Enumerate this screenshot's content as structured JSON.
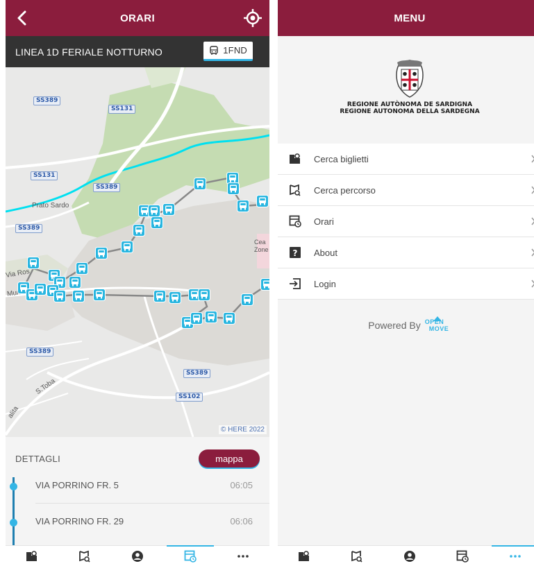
{
  "left_screen": {
    "appbar": {
      "title": "ORARI"
    },
    "line_header": {
      "name": "LINEA 1D FERIALE NOTTURNO",
      "badge": "1FND"
    },
    "map": {
      "road_labels": [
        "SS389",
        "SS131",
        "SS131",
        "SS389",
        "SS389",
        "SS389",
        "SS389",
        "SS102"
      ],
      "place_labels": [
        "Prato Sardo",
        "Via Ros",
        "Muri Chessa",
        "Cea Zone",
        "S.Toba",
        "alita"
      ],
      "copyright": "© HERE 2022"
    },
    "details": {
      "label": "DETTAGLI",
      "map_button": "mappa",
      "stops": [
        {
          "name": "VIA PORRINO FR. 5",
          "time": "06:05"
        },
        {
          "name": "VIA PORRINO FR. 29",
          "time": "06:06"
        }
      ]
    }
  },
  "right_screen": {
    "appbar": {
      "title": "MENU"
    },
    "region": {
      "line1": "REGIONE AUTÒNOMA DE SARDIGNA",
      "line2": "REGIONE AUTONOMA DELLA SARDEGNA"
    },
    "menu_items": [
      {
        "label": "Cerca biglietti",
        "icon": "ticket-search-icon"
      },
      {
        "label": "Cerca percorso",
        "icon": "route-search-icon"
      },
      {
        "label": "Orari",
        "icon": "timetable-icon"
      },
      {
        "label": "About",
        "icon": "question-icon"
      },
      {
        "label": "Login",
        "icon": "login-icon"
      }
    ],
    "powered_by": "Powered By",
    "openmove_logo": {
      "line1": "OPEN",
      "line2": "MOVE"
    }
  },
  "bottom_nav": {
    "items": [
      "ticket-search-icon",
      "route-search-icon",
      "account-icon",
      "timetable-icon",
      "more-icon"
    ],
    "left_active": "timetable-icon",
    "right_active": "more-icon"
  },
  "colors": {
    "brand": "#8b1d3d",
    "accent": "#33b5e5",
    "header_dark": "#333333"
  }
}
